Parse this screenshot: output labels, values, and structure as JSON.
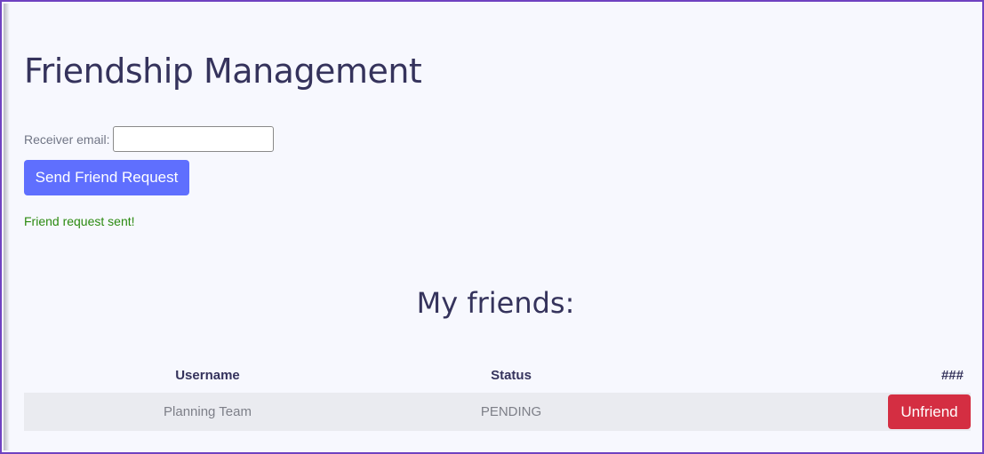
{
  "page": {
    "title": "Friendship Management"
  },
  "form": {
    "label": "Receiver email:",
    "email_value": "",
    "send_button_label": "Send Friend Request",
    "status_message": "Friend request sent!"
  },
  "friends": {
    "heading": "My friends:",
    "columns": [
      "Username",
      "Status",
      "###"
    ],
    "rows": [
      {
        "username": "Planning Team",
        "status": "PENDING",
        "action_label": "Unfriend"
      }
    ]
  },
  "colors": {
    "primary": "#5f6ffe",
    "danger": "#d42e42",
    "success": "#2b8a10",
    "heading": "#35335c",
    "frame_border": "#6f42c1"
  }
}
